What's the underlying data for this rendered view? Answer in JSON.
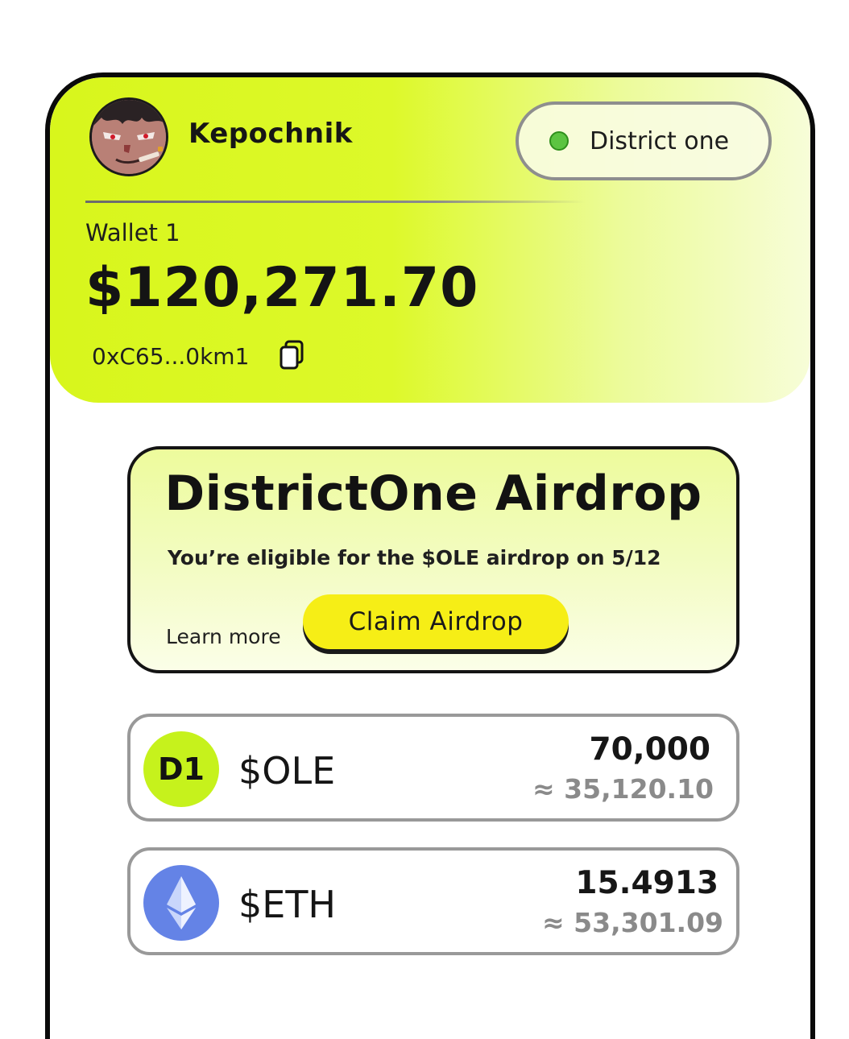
{
  "profile": {
    "username": "Kepochnik",
    "avatar": "avatar-image"
  },
  "network": {
    "label": "District one",
    "status_color": "#5cc441"
  },
  "wallet": {
    "name": "Wallet 1",
    "balance": "$120,271.70",
    "address": "0xC65...0km1",
    "copy_icon": "copy-icon"
  },
  "airdrop": {
    "title": "DistrictOne Airdrop",
    "subtitle": "You’re eligible for the $OLE airdrop on 5/12",
    "learn_more": "Learn more",
    "claim_label": "Claim Airdrop"
  },
  "tokens": [
    {
      "icon": "d1-logo-icon",
      "icon_text": "D1",
      "symbol": "$OLE",
      "amount": "70,000",
      "approx": "≈ 35,120.10",
      "color": "#c6f21c"
    },
    {
      "icon": "ethereum-icon",
      "symbol": "$ETH",
      "amount": "15.4913",
      "approx": "≈ 53,301.09",
      "color": "#6483e6"
    }
  ],
  "colors": {
    "accent": "#ddf92a",
    "button": "#f6ee16"
  }
}
